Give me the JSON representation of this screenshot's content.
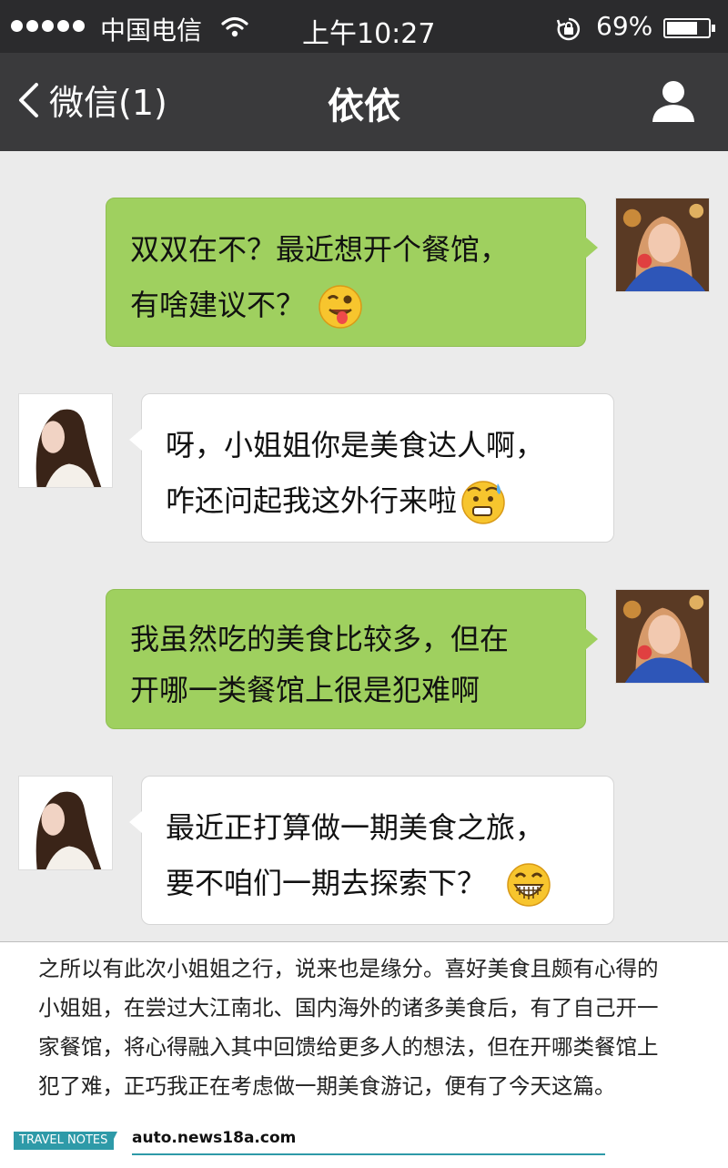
{
  "status_bar": {
    "carrier": "中国电信",
    "time": "上午10:27",
    "battery_percent_label": "69%",
    "battery_level": 0.69,
    "signal_bars": 5,
    "icons": [
      "signal-dots-icon",
      "wifi-icon",
      "rotation-lock-icon",
      "battery-icon"
    ]
  },
  "nav": {
    "back_label": "微信(1)",
    "title": "依依",
    "right_icon": "contact-profile-icon"
  },
  "messages": [
    {
      "side": "me",
      "lines": [
        "双双在不？最近想开个餐馆，",
        "有啥建议不？"
      ],
      "emoji": "winking-tongue-emoji"
    },
    {
      "side": "them",
      "lines": [
        "呀，小姐姐你是美食达人啊，",
        "咋还问起我这外行来啦"
      ],
      "emoji": "sweating-awkward-emoji"
    },
    {
      "side": "me",
      "lines": [
        "我虽然吃的美食比较多，但在",
        "开哪一类餐馆上很是犯难啊"
      ],
      "emoji": ""
    },
    {
      "side": "them",
      "lines": [
        "最近正打算做一期美食之旅，",
        "要不咱们一期去探索下？"
      ],
      "emoji": "grinning-emoji"
    }
  ],
  "article": {
    "lines": [
      "之所以有此次小姐姐之行，说来也是缘分。喜好美食且颇有心得的",
      "小姐姐，在尝过大江南北、国内海外的诸多美食后，有了自己开一",
      "家餐馆，将心得融入其中回馈给更多人的想法，但在开哪类餐馆上",
      "犯了难，正巧我正在考虑做一期美食游记，便有了今天这篇。"
    ]
  },
  "footer": {
    "tag": "TRAVEL NOTES",
    "site": "auto.news18a.com"
  },
  "colors": {
    "status_bar": "#2b2b2d",
    "nav_bar": "#3a3a3c",
    "chat_background": "#ebebeb",
    "my_bubble": "#9fd05f",
    "their_bubble": "#ffffff",
    "footer_accent": "#2e9aa8"
  }
}
